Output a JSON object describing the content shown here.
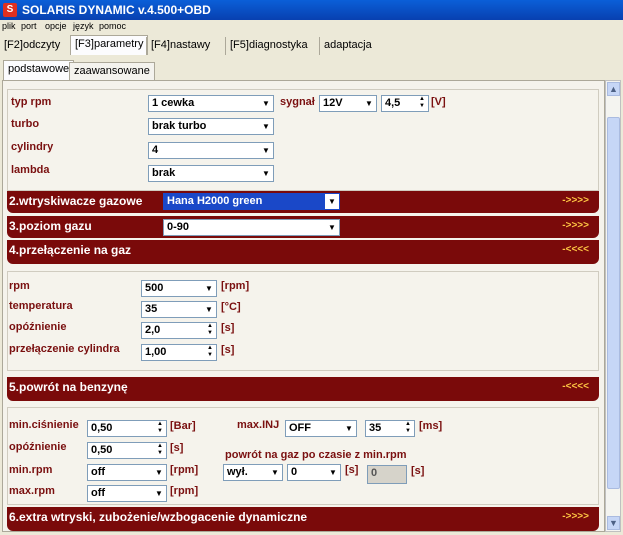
{
  "window": {
    "title": "SOLARIS DYNAMIC v.4.500+OBD",
    "icon": "app-icon"
  },
  "menu": [
    "plik",
    "port",
    "opcje",
    "język",
    "pomoc"
  ],
  "tabs": [
    "[F2]odczyty",
    "[F3]parametry",
    "[F4]nastawy",
    "[F5]diagnostyka",
    "adaptacja"
  ],
  "subtabs": [
    "podstawowe",
    "zaawansowane"
  ],
  "basic": {
    "typ_rpm_label": "typ rpm",
    "typ_rpm_value": "1 cewka",
    "sygnal_label": "sygnał",
    "sygnal_value": "12V",
    "sygnal_num": "4,5",
    "sygnal_unit": "[V]",
    "turbo_label": "turbo",
    "turbo_value": "brak turbo",
    "cylindry_label": "cylindry",
    "cylindry_value": "4",
    "lambda_label": "lambda",
    "lambda_value": "brak"
  },
  "bars": {
    "b2": {
      "title": "2.wtryskiwacze gazowe",
      "value": "Hana H2000 green",
      "arrow": "->>>>"
    },
    "b3": {
      "title": "3.poziom gazu",
      "value": "0-90",
      "arrow": "->>>>"
    },
    "b4": {
      "title": "4.przełączenie na gaz",
      "arrow": "-<<<<"
    },
    "b5": {
      "title": "5.powrót na benzynę",
      "arrow": "-<<<<"
    },
    "b6": {
      "title": "6.extra wtryski, zubożenie/wzbogacenie dynamiczne",
      "arrow": "->>>>"
    }
  },
  "switch": {
    "rpm_label": "rpm",
    "rpm_value": "500",
    "rpm_unit": "[rpm]",
    "temp_label": "temperatura",
    "temp_value": "35",
    "temp_unit": "[°C]",
    "delay_label": "opóźnienie",
    "delay_value": "2,0",
    "delay_unit": "[s]",
    "cyl_label": "przełączenie cylindra",
    "cyl_value": "1,00",
    "cyl_unit": "[s]"
  },
  "ret": {
    "minp_label": "min.ciśnienie",
    "minp_value": "0,50",
    "minp_unit": "[Bar]",
    "delay_label": "opóźnienie",
    "delay_value": "0,50",
    "delay_unit": "[s]",
    "minrpm_label": "min.rpm",
    "minrpm_value": "off",
    "minrpm_unit": "[rpm]",
    "maxrpm_label": "max.rpm",
    "maxrpm_value": "off",
    "maxrpm_unit": "[rpm]",
    "maxinj_label": "max.INJ",
    "maxinj_value": "OFF",
    "maxinj_num": "35",
    "maxinj_unit": "[ms]",
    "back_label": "powrót na gaz po czasie z min.rpm",
    "back_sel": "wył.",
    "back_num": "0",
    "back_unit1": "[s]",
    "back_ro": "0",
    "back_unit2": "[s]"
  }
}
